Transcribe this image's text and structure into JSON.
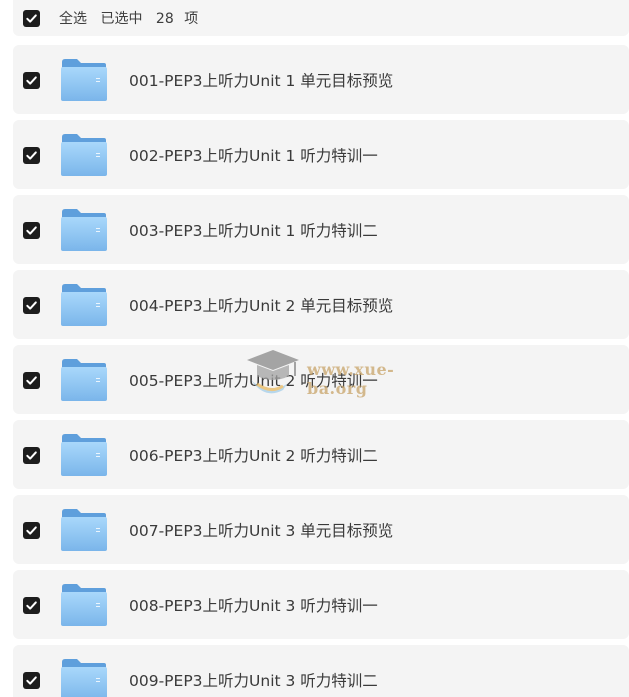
{
  "header": {
    "select_all_label": "全选",
    "selected_prefix": "已选中",
    "selected_count": "28",
    "selected_suffix": "项"
  },
  "items": [
    {
      "label": "001-PEP3上听力Unit 1 单元目标预览",
      "checked": true
    },
    {
      "label": "002-PEP3上听力Unit 1 听力特训一",
      "checked": true
    },
    {
      "label": "003-PEP3上听力Unit 1 听力特训二",
      "checked": true
    },
    {
      "label": "004-PEP3上听力Unit 2 单元目标预览",
      "checked": true
    },
    {
      "label": "005-PEP3上听力Unit 2 听力特训一",
      "checked": true
    },
    {
      "label": "006-PEP3上听力Unit 2 听力特训二",
      "checked": true
    },
    {
      "label": "007-PEP3上听力Unit 3 单元目标预览",
      "checked": true
    },
    {
      "label": "008-PEP3上听力Unit 3 听力特训一",
      "checked": true
    },
    {
      "label": "009-PEP3上听力Unit 3 听力特训二",
      "checked": true
    }
  ],
  "watermark": {
    "text": "www.xue-ba.org"
  },
  "colors": {
    "row_background": "#f4f4f4",
    "checkbox": "#1d1d1d",
    "folder_blue": "#7bb8ee",
    "watermark": "#c9a56a"
  },
  "icons": {
    "checkbox": "checkmark-icon",
    "item": "folder-icon",
    "watermark": "graduation-cap-icon"
  }
}
